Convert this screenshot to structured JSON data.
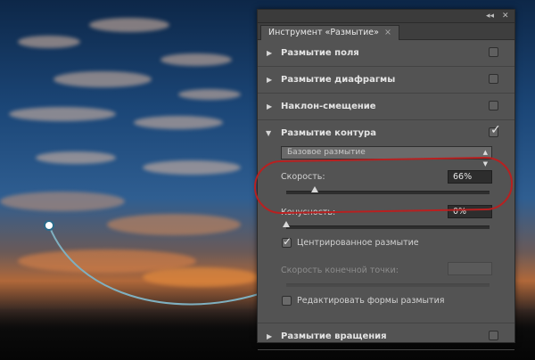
{
  "panel": {
    "collapse_label": "◂◂",
    "close_label": "✕",
    "tab_title": "Инструмент «Размытие»",
    "tab_close": "×"
  },
  "sections": {
    "field": {
      "title": "Размытие поля",
      "enabled": false
    },
    "iris": {
      "title": "Размытие диафрагмы",
      "enabled": false
    },
    "tilt": {
      "title": "Наклон-смещение",
      "enabled": false
    },
    "path": {
      "title": "Размытие контура",
      "enabled": true
    },
    "spin": {
      "title": "Размытие вращения",
      "enabled": false
    }
  },
  "path_blur": {
    "preset_value": "Базовое размытие",
    "speed_label": "Скорость:",
    "speed_value": "66%",
    "speed_level": 0.66,
    "taper_label": "Конусность:",
    "taper_value": "0%",
    "taper_level": 0.0,
    "centered_label": "Центрированное размытие",
    "centered_checked": true,
    "end_speed_label": "Скорость конечной точки:",
    "end_speed_value": "",
    "edit_shapes_label": "Редактировать формы размытия",
    "edit_shapes_checked": false
  },
  "icons": {
    "expand": "triangle-right-icon",
    "collapse": "triangle-down-icon",
    "check": "checkmark-icon"
  },
  "colors": {
    "panel_bg": "#535353",
    "highlight_ring": "#b82020",
    "curve": "#7fb0c0"
  }
}
